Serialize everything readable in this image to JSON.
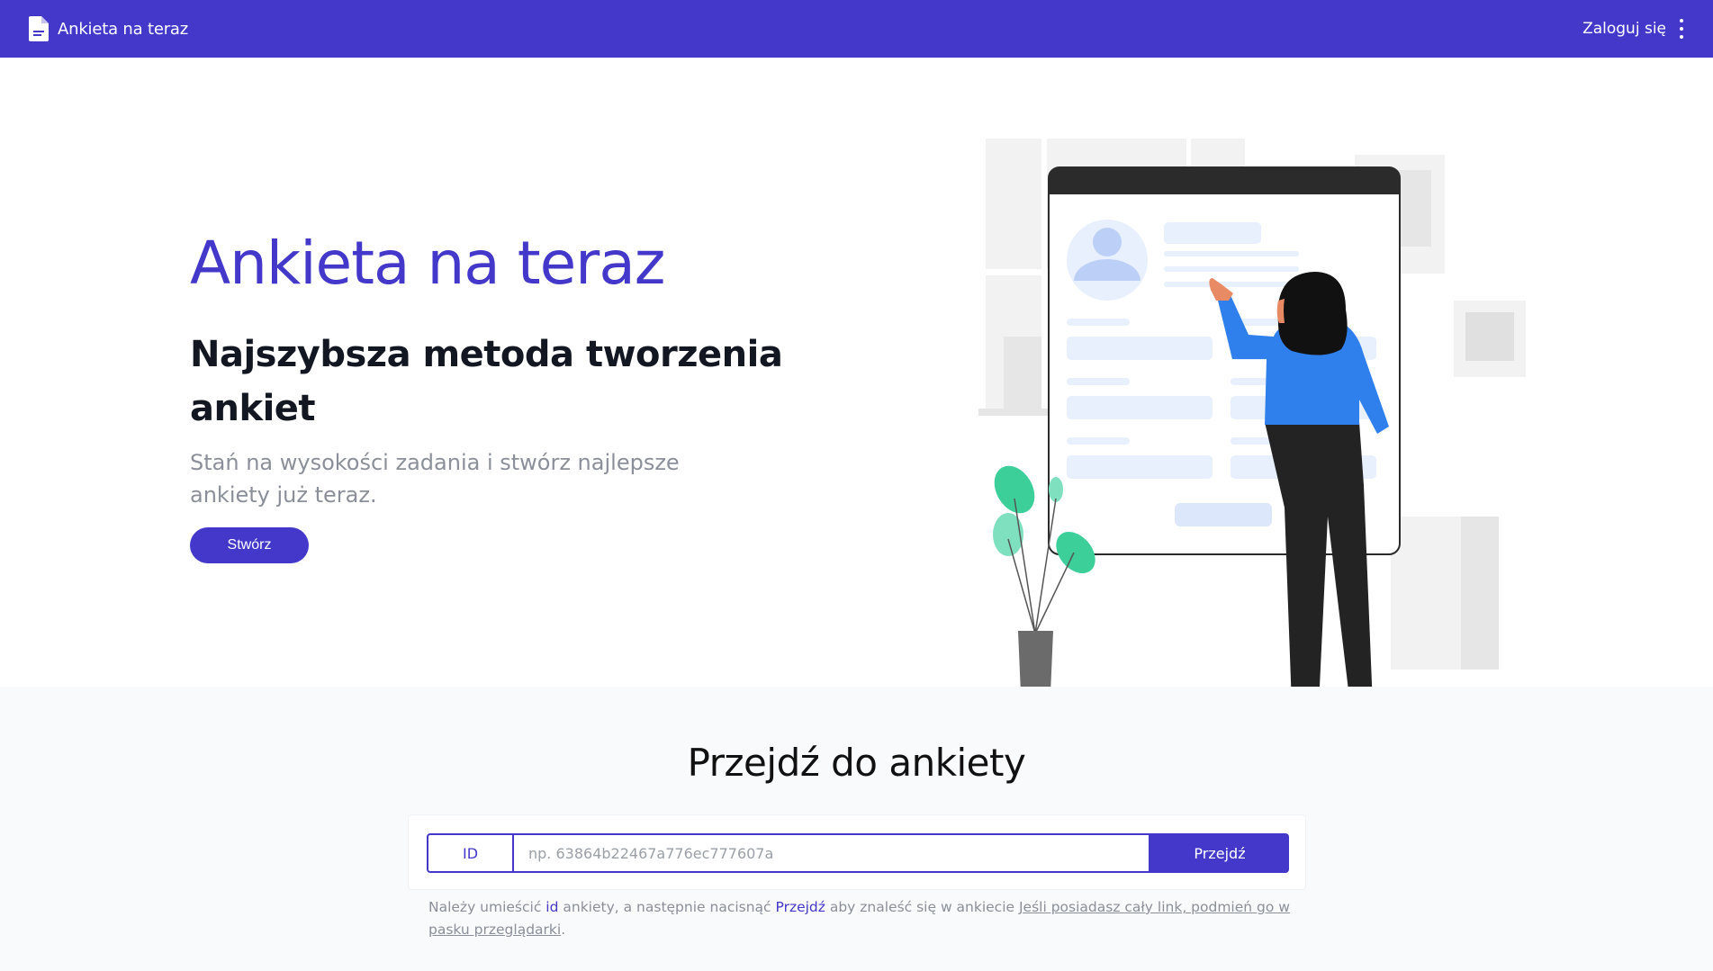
{
  "app": {
    "brand": "Ankieta na teraz",
    "login_label": "Zaloguj się"
  },
  "hero": {
    "title": "Ankieta na teraz",
    "subtitle": "Najszybsza metoda tworzenia ankiet",
    "description": "Stań na wysokości zadania i stwórz najlepsze ankiety już teraz.",
    "create_label": "Stwórz"
  },
  "goto": {
    "title": "Przejdź do ankiety",
    "id_label": "ID",
    "input_value": "",
    "input_placeholder": "np. 63864b22467a776ec777607a",
    "go_label": "Przejdź",
    "hint_part1": "Należy umieścić ",
    "hint_id": "id",
    "hint_part2": " ankiety, a następnie nacisnąć ",
    "hint_go": "Przejdź",
    "hint_part3": " aby znaleść się w ankiecie ",
    "hint_link": "Jeśli posiadasz cały link, podmień go w pasku przeglądarki",
    "hint_end": "."
  },
  "colors": {
    "accent": "#4338ca",
    "heading": "#131722",
    "muted": "#8b8f99",
    "illustration_blue": "#2f80ed",
    "illustration_green": "#3ccf9a"
  }
}
